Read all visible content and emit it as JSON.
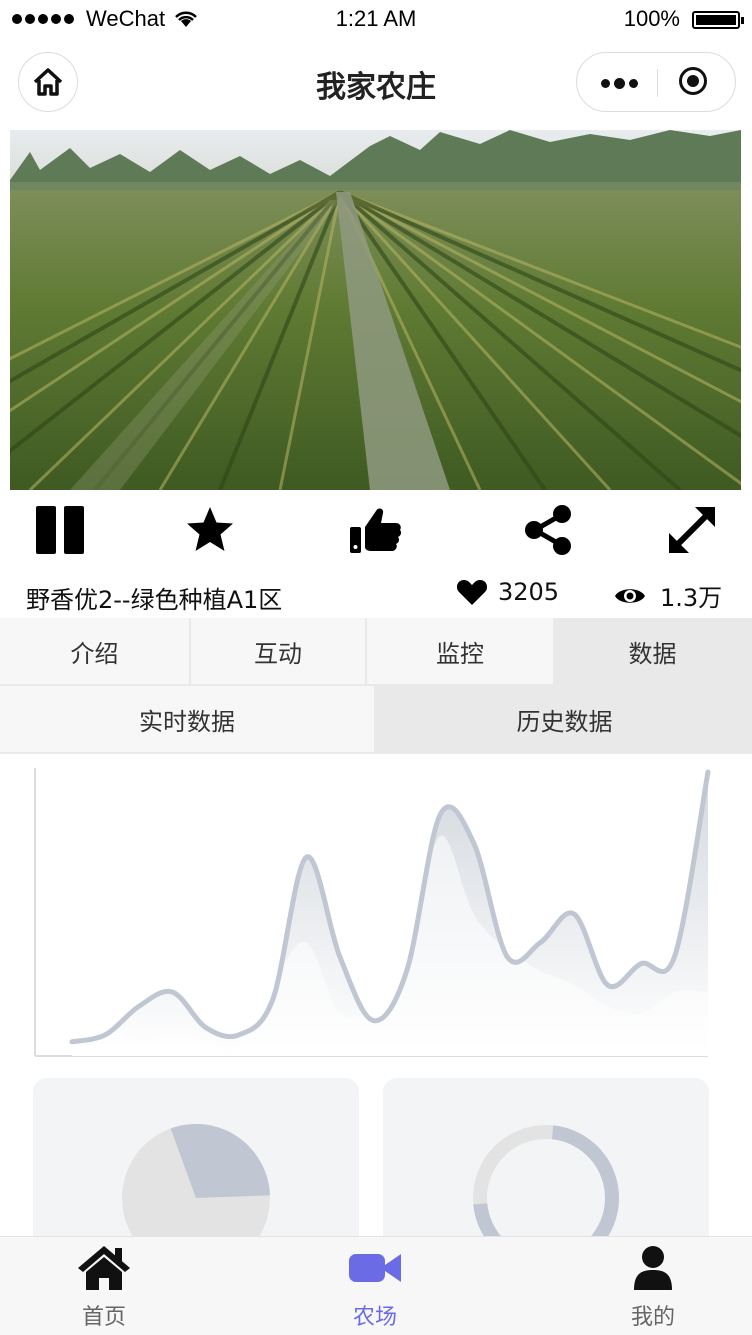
{
  "status_bar": {
    "carrier": "WeChat",
    "time": "1:21 AM",
    "battery": "100%"
  },
  "nav": {
    "title": "我家农庄"
  },
  "video": {
    "state": "playing"
  },
  "field": {
    "name": "野香优2--绿色种植A1区",
    "likes": "3205",
    "views": "1.3万"
  },
  "tabs": [
    {
      "label": "介绍",
      "active": false
    },
    {
      "label": "互动",
      "active": false
    },
    {
      "label": "监控",
      "active": false
    },
    {
      "label": "数据",
      "active": true
    }
  ],
  "subtabs": [
    {
      "label": "实时数据",
      "active": false
    },
    {
      "label": "历史数据",
      "active": true
    }
  ],
  "chart_data": {
    "type": "area",
    "x": [
      0,
      1,
      2,
      3,
      4,
      5,
      6,
      7,
      8,
      9,
      10,
      11,
      12,
      13,
      14,
      15,
      16,
      17,
      18,
      19
    ],
    "series": [
      {
        "values": [
          2,
          3,
          7,
          9,
          4,
          3,
          8,
          28,
          14,
          5,
          12,
          34,
          30,
          14,
          16,
          20,
          10,
          13,
          14,
          40
        ]
      },
      {
        "values": [
          1,
          4,
          2,
          3,
          2,
          1,
          10,
          16,
          6,
          7,
          15,
          31,
          20,
          15,
          12,
          10,
          7,
          6,
          9,
          9
        ]
      }
    ],
    "ylim": [
      0,
      40
    ],
    "grid": false,
    "colors": {
      "line": "#c0c7d2",
      "fill": "#e6e8ec"
    }
  },
  "cards": {
    "pie": {
      "type": "pie",
      "slices": [
        70,
        30
      ],
      "colors": [
        "#e3e3e3",
        "#c0c7d2"
      ]
    },
    "ring": {
      "type": "donut",
      "value": 0.72,
      "colors": [
        "#c0c7d2",
        "#e3e3e3"
      ]
    }
  },
  "tabbar": [
    {
      "label": "首页",
      "icon": "house-icon",
      "active": false
    },
    {
      "label": "农场",
      "icon": "video-camera-icon",
      "active": true
    },
    {
      "label": "我的",
      "icon": "user-icon",
      "active": false
    }
  ],
  "colors": {
    "accent": "#6c6be6",
    "tab_active_bg": "#e9e9e9",
    "tab_bg": "#f7f7f7"
  }
}
